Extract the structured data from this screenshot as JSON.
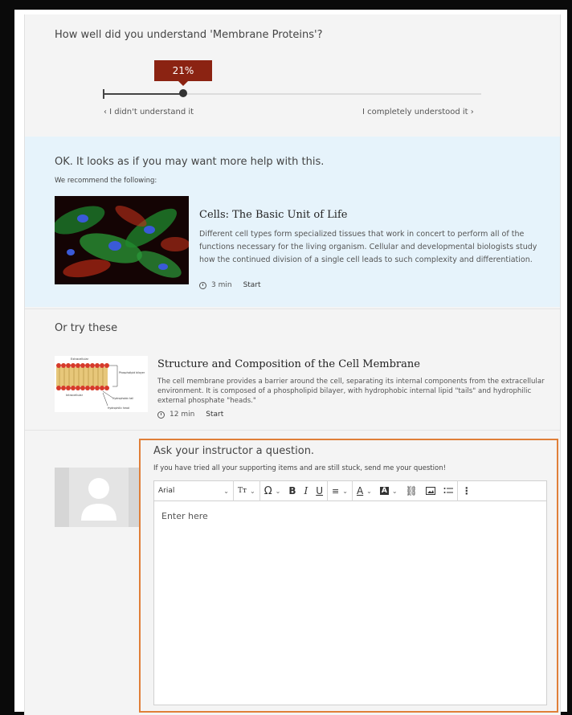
{
  "question": {
    "title": "How well did you understand 'Membrane Proteins'?",
    "value_percent": 21,
    "value_label": "21%",
    "left_label": "‹  I didn't understand it",
    "right_label": "I completely understood it  ›"
  },
  "recommend": {
    "heading": "OK. It looks as if you may want more help with this.",
    "subheading": "We recommend the following:",
    "item": {
      "title": "Cells: The Basic Unit of Life",
      "description": "Different cell types form specialized tissues that work in concert to perform all of the functions necessary for the living organism. Cellular and developmental biologists study how the continued division of a single cell leads to such complexity and differentiation.",
      "duration": "3 min",
      "start_label": "Start"
    }
  },
  "try_these": {
    "heading": "Or try these",
    "item": {
      "title": "Structure and Composition of the Cell Membrane",
      "description": "The cell membrane provides a barrier around the cell, separating its internal components from the extracellular environment. It is composed of a phospholipid bilayer, with hydrophobic internal lipid \"tails\" and hydrophilic external phosphate \"heads.\"",
      "duration": "12 min",
      "start_label": "Start",
      "diagram_labels": [
        "Extracellular",
        "Phospholipid bilayer",
        "Intracellular",
        "Hydrophobic tail",
        "Hydrophilic head"
      ]
    }
  },
  "ask": {
    "heading": "Ask your instructor a question.",
    "subheading": "If you have tried all your supporting items and are still stuck, send me your question!",
    "font_value": "Arial",
    "editor_placeholder": "Enter here",
    "toolbar_icons": [
      "font-size-icon",
      "special-char-icon",
      "bold-icon",
      "italic-icon",
      "underline-icon",
      "align-icon",
      "text-color-icon",
      "highlight-icon",
      "link-icon",
      "image-icon",
      "list-icon",
      "more-icon"
    ]
  },
  "colors": {
    "accent_tooltip": "#8b2312",
    "highlight_border": "#e07f38",
    "recommend_bg": "#e6f3fb"
  }
}
